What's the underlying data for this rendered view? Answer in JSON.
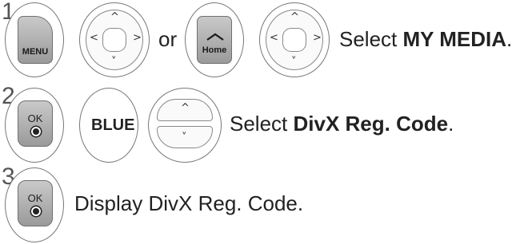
{
  "steps": [
    {
      "number": "1",
      "buttons": {
        "menu": "MENU",
        "or": "or",
        "home": "Home"
      },
      "instruction_prefix": "Select ",
      "instruction_bold": "MY MEDIA",
      "instruction_suffix": "."
    },
    {
      "number": "2",
      "buttons": {
        "ok": "OK",
        "blue": "BLUE"
      },
      "instruction_prefix": "Select ",
      "instruction_bold": "DivX Reg. Code",
      "instruction_suffix": "."
    },
    {
      "number": "3",
      "buttons": {
        "ok": "OK"
      },
      "instruction": "Display DivX Reg. Code."
    }
  ],
  "icons": {
    "nav_up": "chevron-up-icon",
    "nav_down": "chevron-down-icon",
    "nav_left": "chevron-left-icon",
    "nav_right": "chevron-right-icon",
    "home": "home-icon",
    "ok_dot": "dot-icon"
  }
}
